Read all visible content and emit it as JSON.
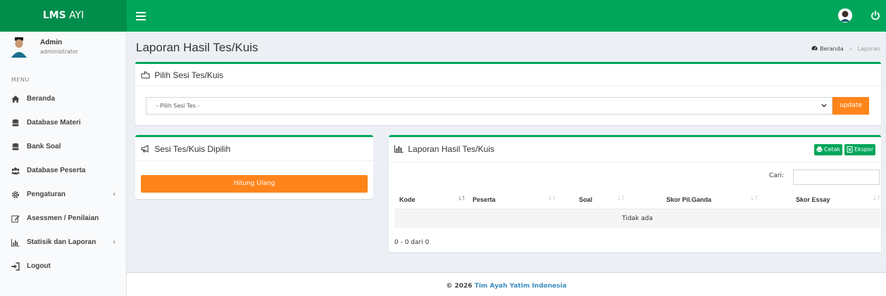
{
  "brand": {
    "bold": "LMS",
    "light": "AYI"
  },
  "user": {
    "name": "Admin",
    "role": "administrator"
  },
  "sidebar": {
    "menu_header": "MENU",
    "items": [
      {
        "label": "Beranda",
        "icon": "home-icon"
      },
      {
        "label": "Database Materi",
        "icon": "database-icon"
      },
      {
        "label": "Bank Soal",
        "icon": "database-icon"
      },
      {
        "label": "Database Peserta",
        "icon": "users-icon"
      },
      {
        "label": "Pengaturan",
        "icon": "gear-icon",
        "has_submenu": true
      },
      {
        "label": "Asessmen / Penilaian",
        "icon": "edit-icon"
      },
      {
        "label": "Statisik dan Laporan",
        "icon": "bar-chart-icon",
        "has_submenu": true
      },
      {
        "label": "Logout",
        "icon": "sign-in-icon"
      }
    ]
  },
  "page": {
    "title": "Laporan Hasil Tes/Kuis",
    "breadcrumb": {
      "home": "Beranda",
      "current": "Laporan"
    }
  },
  "select_box": {
    "title": "Pilih Sesi Tes/Kuis",
    "select_value": "- Pilih Sesi Tes -",
    "update_label": "update"
  },
  "session_box": {
    "title": "Sesi Tes/Kuis Dipilih",
    "recalc_label": "Hitung Ulang"
  },
  "report_box": {
    "title": "Laporan Hasil Tes/Kuis",
    "print_label": "Cetak",
    "export_label": "Ekspor",
    "search_label": "Cari:",
    "search_value": "",
    "columns": [
      "Kode",
      "Peserta",
      "Soal",
      "Skor Pil.Ganda",
      "Skor Essay"
    ],
    "empty_text": "Tidak ada",
    "info": "0 - 0 dari 0"
  },
  "footer": {
    "copyright": "© 2026",
    "org": "Tim Ayah Yatim Indonesia"
  },
  "colors": {
    "primary": "#00a65a",
    "primary_dark": "#008d4c",
    "accent": "#ff851b",
    "link": "#3c8dbc"
  }
}
